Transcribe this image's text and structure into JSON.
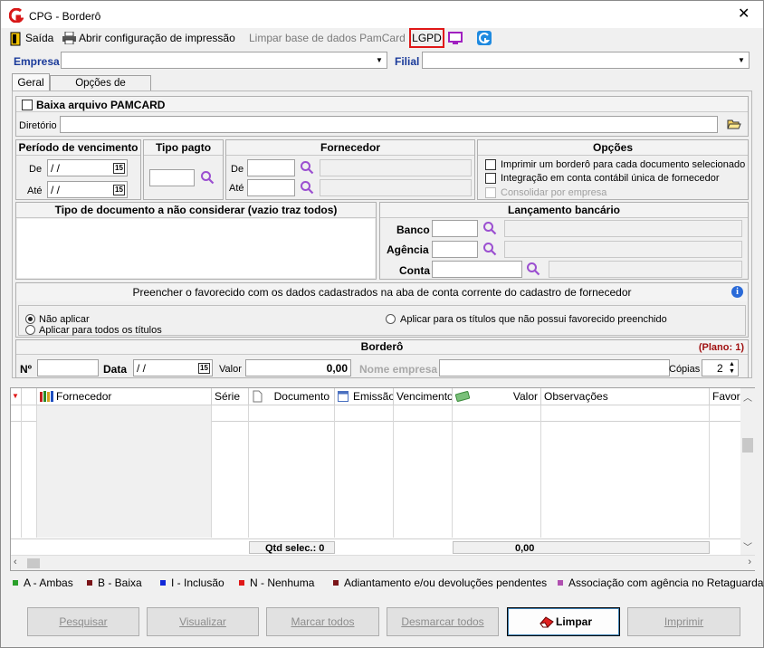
{
  "window": {
    "title": "CPG - Borderô",
    "close_glyph": "✕"
  },
  "toolbar": {
    "exit": "Saída",
    "print_config": "Abrir configuração de impressão",
    "clear_pamcard": "Limpar base de dados PamCard",
    "lgpd": "LGPD"
  },
  "company": {
    "label": "Empresa",
    "value": "",
    "branch_label": "Filial",
    "branch_value": ""
  },
  "tabs": [
    {
      "label": "Geral"
    },
    {
      "label": "Opções de impressão"
    }
  ],
  "pamcard": {
    "checkbox_label": "Baixa arquivo PAMCARD",
    "checked": false,
    "dir_label": "Diretório",
    "dir_value": ""
  },
  "period": {
    "title": "Período de vencimento",
    "from_label": "De",
    "from_value": " /  /",
    "to_label": "Até",
    "to_value": " /  /",
    "cal_glyph": "15"
  },
  "payment_type": {
    "title": "Tipo pagto",
    "value": ""
  },
  "supplier": {
    "title": "Fornecedor",
    "from_label": "De",
    "to_label": "Até"
  },
  "options": {
    "title": "Opções",
    "items": [
      {
        "label": "Imprimir um borderô para cada documento selecionado",
        "checked": false,
        "enabled": true
      },
      {
        "label": "Integração em conta contábil única de fornecedor",
        "checked": false,
        "enabled": true
      },
      {
        "label": "Consolidar por empresa",
        "checked": false,
        "enabled": false
      }
    ]
  },
  "doc_types": {
    "title": "Tipo de documento a não considerar (vazio traz todos)"
  },
  "bank": {
    "title": "Lançamento bancário",
    "bank_label": "Banco",
    "agency_label": "Agência",
    "account_label": "Conta"
  },
  "favored": {
    "title": "Preencher o favorecido com os dados cadastrados na aba de conta corrente do cadastro de fornecedor",
    "info_glyph": "i",
    "opt1": "Não aplicar",
    "opt2": "Aplicar para todos os títulos",
    "opt3": "Aplicar para os títulos que não possui favorecido preenchido",
    "selected": "Não aplicar"
  },
  "bordero": {
    "title": "Borderô",
    "plan": "(Plano: 1)",
    "num_label": "Nº",
    "num_value": "",
    "date_label": "Data",
    "date_value": " /  /",
    "value_label": "Valor",
    "value_value": "0,00",
    "company_name_label": "Nome empresa",
    "copies_label": "Cópias",
    "copies_value": "2"
  },
  "grid": {
    "headers": [
      "Fornecedor",
      "Série",
      "Documento",
      "Emissão",
      "Vencimento",
      "Valor",
      "Observações",
      "Favore"
    ],
    "footer_qtd": "Qtd selec.: 0",
    "footer_total": "0,00"
  },
  "legend": [
    {
      "label": "A - Ambas",
      "color": "#2aa02a"
    },
    {
      "label": "B - Baixa",
      "color": "#7a1418"
    },
    {
      "label": "I - Inclusão",
      "color": "#1028d8"
    },
    {
      "label": "N - Nenhuma",
      "color": "#e01818"
    },
    {
      "label": "Adiantamento e/ou devoluções pendentes",
      "color": "#7a1418"
    },
    {
      "label": "Associação com agência no Retaguarda",
      "color": "#b050b0"
    }
  ],
  "buttons": {
    "search": "Pesquisar",
    "view": "Visualizar",
    "select_all": "Marcar todos",
    "deselect_all": "Desmarcar todos",
    "clear": "Limpar",
    "print": "Imprimir"
  },
  "colors": {
    "accent": "#1a3a9a",
    "plan": "#a01010",
    "lgpd_border": "#e01818",
    "magnifier": "#9b4fd0"
  }
}
